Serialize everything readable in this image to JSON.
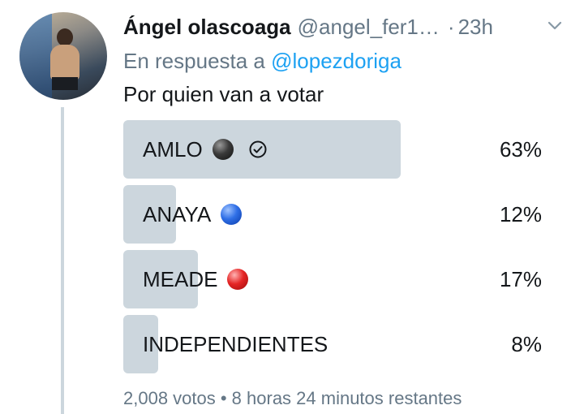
{
  "tweet": {
    "name": "Ángel olascoaga",
    "handle": "@angel_fer1…",
    "separator": "·",
    "time": "23h",
    "reply_prefix": "En respuesta a",
    "reply_mention": "@lopezdoriga",
    "text": "Por quien van a votar"
  },
  "poll": {
    "options": [
      {
        "label": "AMLO",
        "icon": "black-circle-icon",
        "percent_text": "63%",
        "percent": 63,
        "selected": true
      },
      {
        "label": "ANAYA",
        "icon": "blue-circle-icon",
        "percent_text": "12%",
        "percent": 12,
        "selected": false
      },
      {
        "label": "MEADE",
        "icon": "red-circle-icon",
        "percent_text": "17%",
        "percent": 17,
        "selected": false
      },
      {
        "label": "INDEPENDIENTES",
        "icon": "",
        "percent_text": "8%",
        "percent": 8,
        "selected": false
      }
    ],
    "footer": "2,008 votos • 8 horas 24 minutos restantes"
  },
  "colors": {
    "bar": "#ccd6dd",
    "link": "#1da1f2",
    "muted": "#657786",
    "text": "#14171a",
    "thread_line": "#ccd6dd"
  }
}
